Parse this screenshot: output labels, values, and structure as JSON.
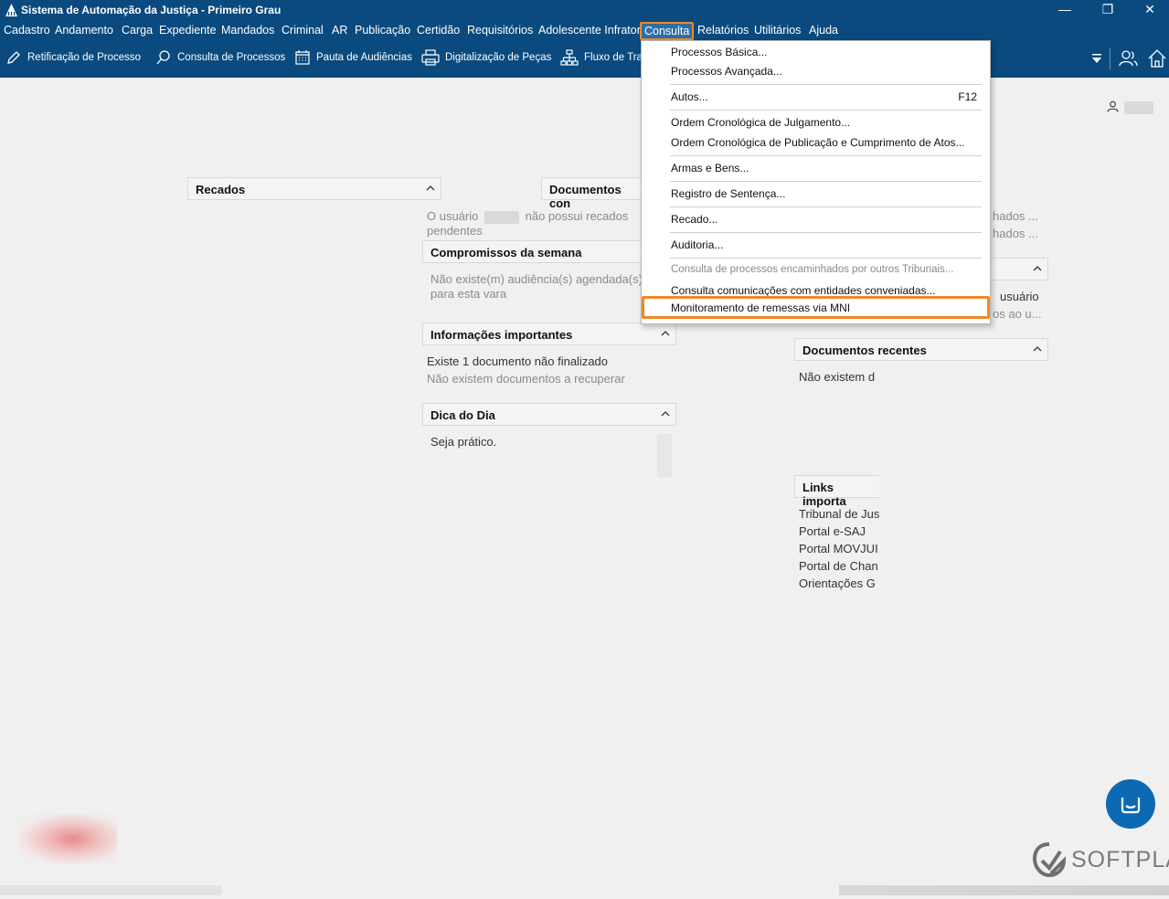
{
  "window": {
    "title": "Sistema de Automação da Justiça - Primeiro Grau",
    "minimize": "—",
    "restore": "❐",
    "close": "✕"
  },
  "menu": [
    "Cadastro",
    "Andamento",
    "Carga",
    "Expediente",
    "Mandados",
    "Criminal",
    "AR",
    "Publicação",
    "Certidão",
    "Requisitórios",
    "Adolescente Infrator",
    "Consulta",
    "Relatórios",
    "Utilitários",
    "Ajuda"
  ],
  "toolbar": [
    {
      "label": "Retificação de Processo",
      "icon": "edit-icon"
    },
    {
      "label": "Consulta de Processos",
      "icon": "search-icon"
    },
    {
      "label": "Pauta de Audiências",
      "icon": "calendar-icon"
    },
    {
      "label": "Digitalização de Peças",
      "icon": "printer-icon"
    },
    {
      "label": "Fluxo de Trab",
      "icon": "flow-icon"
    }
  ],
  "dropdown": {
    "items": [
      {
        "label": "Processos Básica...",
        "shortcut": ""
      },
      {
        "label": "Processos Avançada...",
        "shortcut": ""
      },
      {
        "label": "Autos...",
        "shortcut": "F12"
      },
      {
        "label": "Ordem Cronológica de Julgamento...",
        "shortcut": ""
      },
      {
        "label": "Ordem Cronológica de Publicação e Cumprimento de Atos...",
        "shortcut": ""
      },
      {
        "label": "Armas e Bens...",
        "shortcut": ""
      },
      {
        "label": "Registro de Sentença...",
        "shortcut": ""
      },
      {
        "label": "Recado...",
        "shortcut": ""
      },
      {
        "label": "Auditoria...",
        "shortcut": ""
      },
      {
        "label": "Consulta de processos encaminhados por outros Tribunais...",
        "shortcut": ""
      },
      {
        "label": "Consulta comunicações com entidades conveniadas...",
        "shortcut": ""
      },
      {
        "label": "Monitoramento de remessas via MNI",
        "shortcut": ""
      }
    ]
  },
  "panels": {
    "recados": {
      "title": "Recados"
    },
    "documentos_con": {
      "title": "Documentos con"
    },
    "recados_empty": {
      "prefix": "O usuário",
      "suffix": "não possui recados",
      "line2": "pendentes"
    },
    "compromissos": {
      "title": "Compromissos da semana",
      "line1": "Não existe(m) audiência(s) agendada(s)",
      "line2": "para esta vara"
    },
    "informacoes": {
      "title": "Informações importantes",
      "line1": "Existe 1 documento não finalizado",
      "line2": "Não existem documentos a recuperar"
    },
    "dica": {
      "title": "Dica do Dia",
      "text": "Seja prático."
    },
    "right_col": {
      "frag1": "hados ...",
      "frag2": "hados ...",
      "frag3": "usuário",
      "frag4": "os ao u..."
    },
    "documentos_recentes": {
      "title": "Documentos recentes",
      "text": "Não existem d"
    },
    "links": {
      "title": "Links importa",
      "items": [
        "Tribunal de Jus",
        "Portal e-SAJ",
        "Portal MOVJUI",
        "Portal de Chan",
        "Orientações G"
      ]
    }
  },
  "brand": {
    "name": "SOFTPLAN"
  },
  "colors": {
    "chrome": "#0a4a7e",
    "highlight": "#f08a24",
    "chat": "#0c6ab5"
  }
}
